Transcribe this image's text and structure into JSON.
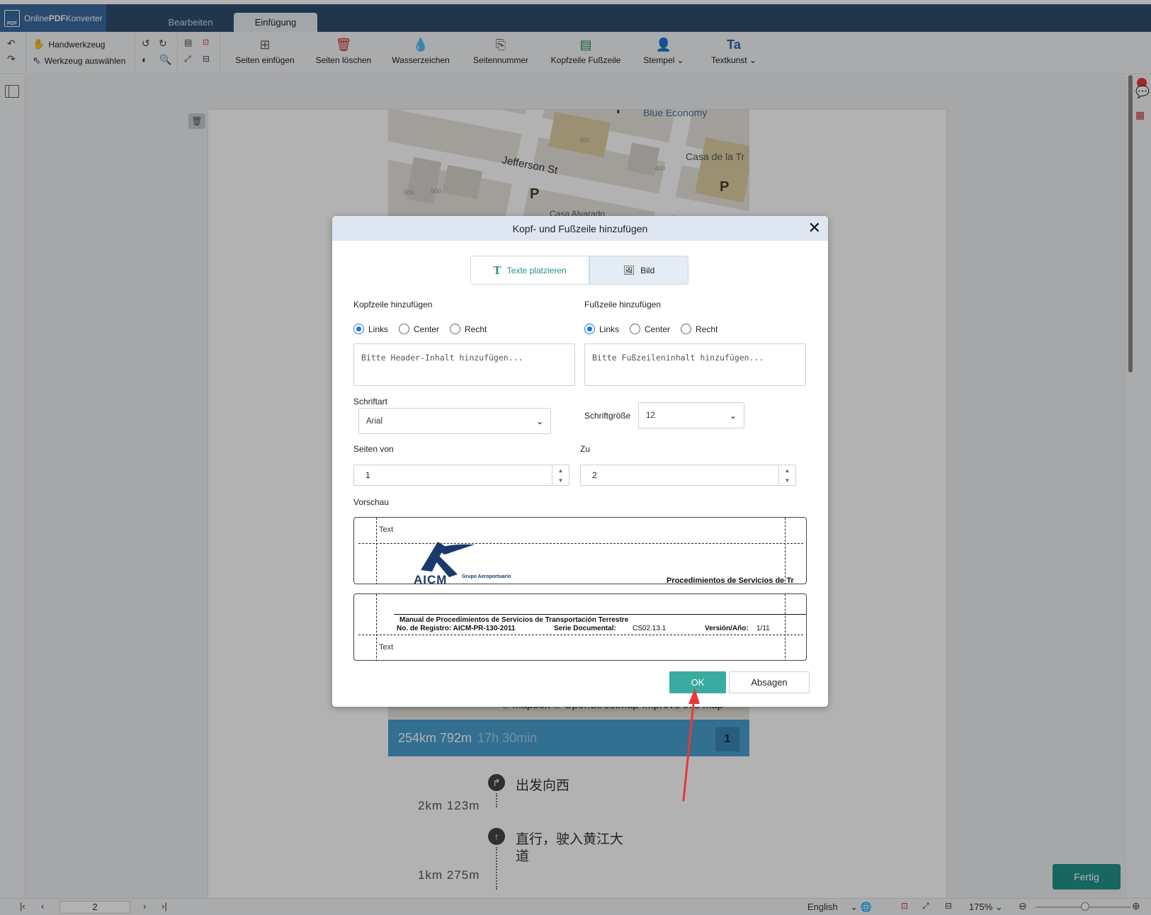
{
  "app": {
    "title": "OnlinePDFKonverter",
    "title_prefix": "Online",
    "title_bold": "PDF",
    "title_suffix": "Konverter",
    "logo_icon_text": "PDF"
  },
  "tabs": [
    {
      "label": "Bearbeiten"
    },
    {
      "label": "Einfügung"
    }
  ],
  "toolbar": {
    "hand_tool": "Handwerkzeug",
    "select_tool": "Werkzeug auswählen",
    "insert_pages": "Seiten einfügen",
    "delete_pages": "Seiten löschen",
    "watermark": "Wasserzeichen",
    "page_number": "Seitennummer",
    "header_footer": "Kopfzeile Fußzeile",
    "stamp": "Stempel",
    "wordart": "Textkunst",
    "wordart_icon": "Ta"
  },
  "map": {
    "labels": {
      "blue_economy": "Blue Economy",
      "jefferson": "Jefferson St",
      "casa": "Casa de la Tr",
      "casa2": "Casa Alvarado",
      "attribution": "© Mapbox © OpenStreetMap  Improve this map",
      "parking": "P",
      "b1": "506",
      "b2": "500",
      "b3": "401",
      "b4": "400"
    }
  },
  "route": {
    "distance": "254km 792m",
    "time": "17h 30min",
    "badge": "1"
  },
  "steps": [
    {
      "instruction": "出发向西",
      "distance": "2km 123m"
    },
    {
      "instruction": "直行，驶入黄江大",
      "instruction2": "道",
      "distance": "1km 275m"
    }
  ],
  "fertig": "Fertig",
  "statusbar": {
    "page": "2",
    "language": "English",
    "zoom": "175%"
  },
  "dialog": {
    "title": "Kopf- und Fußzeile hinzufügen",
    "tabs": {
      "text": "Texte platzieren",
      "image": "Bild"
    },
    "header": {
      "label": "Kopfzeile hinzufügen",
      "options": [
        "Links",
        "Center",
        "Recht"
      ],
      "selected": "Links",
      "placeholder": "Bitte Header-Inhalt hinzufügen..."
    },
    "footer": {
      "label": "Fußzeile hinzufügen",
      "options": [
        "Links",
        "Center",
        "Recht"
      ],
      "selected": "Links",
      "placeholder": "Bitte Fußzeileninhalt hinzufügen..."
    },
    "font": {
      "label": "Schriftart",
      "value": "Arial"
    },
    "font_size": {
      "label": "Schriftgröße",
      "value": "12"
    },
    "pages_from": {
      "label": "Seiten von",
      "value": "1"
    },
    "pages_to": {
      "label": "Zu",
      "value": "2"
    },
    "preview": {
      "label": "Vorschau",
      "header_text": "Text",
      "footer_text": "Text",
      "logo_text": "AICM",
      "logo_sub": "Grupo Aeroportuario",
      "header_right": "Procedimientos de Servicios de Tr",
      "doc_title": "Manual de Procedimientos de Servicios de Transportación Terrestre",
      "reg_label": "No. de Registro: AICM-PR-130-2011",
      "serie_label": "Serie Documental:",
      "serie_value": "CS02.13.1",
      "version_label": "Versión/Año:",
      "version_value": "1/11"
    },
    "ok": "OK",
    "cancel": "Absagen"
  },
  "colors": {
    "accent": "#3aaba1",
    "titlebar": "#2e4e6f",
    "route": "#4a9fd0",
    "arrow": "#e53935"
  }
}
